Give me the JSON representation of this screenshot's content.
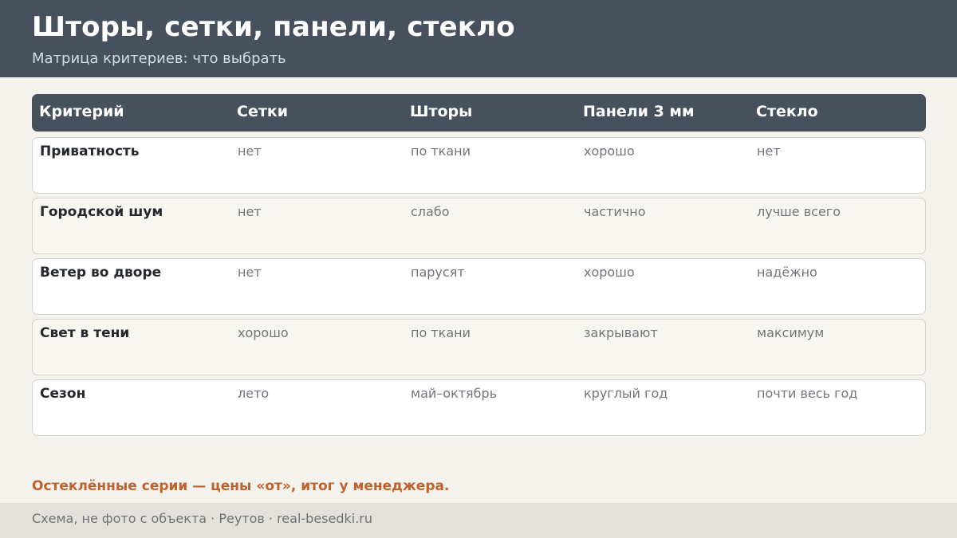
{
  "header": {
    "title": "Шторы, сетки, панели, стекло",
    "subtitle": "Матрица критериев: что выбрать"
  },
  "table": {
    "columns": [
      "Критерий",
      "Сетки",
      "Шторы",
      "Панели 3 мм",
      "Стекло"
    ],
    "rows": [
      {
        "label": "Приватность",
        "values": [
          "нет",
          "по ткани",
          "хорошо",
          "нет"
        ]
      },
      {
        "label": "Городской шум",
        "values": [
          "нет",
          "слабо",
          "частично",
          "лучше всего"
        ]
      },
      {
        "label": "Ветер во дворе",
        "values": [
          "нет",
          "парусят",
          "хорошо",
          "надёжно"
        ]
      },
      {
        "label": "Свет в тени",
        "values": [
          "хорошо",
          "по ткани",
          "закрывают",
          "максимум"
        ]
      },
      {
        "label": "Сезон",
        "values": [
          "лето",
          "май–октябрь",
          "круглый год",
          "почти весь год"
        ]
      }
    ]
  },
  "note": "Остеклённые серии — цены «от», итог у менеджера.",
  "footer": {
    "text": "Схема, не фото с объекта  ·  Реутов  ·  real-besedki.ru"
  },
  "colors": {
    "header_bg": "#47505d",
    "page_bg": "#f4f2ed",
    "accent": "#c0622e",
    "footer_bg": "#e4e1da"
  }
}
